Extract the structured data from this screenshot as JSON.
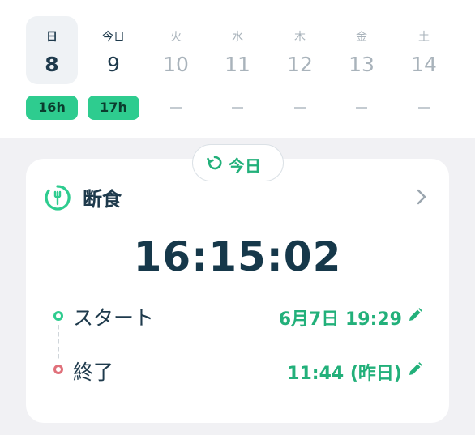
{
  "week": {
    "days": [
      {
        "dow": "日",
        "num": "8",
        "badge": "16h",
        "selected": true
      },
      {
        "dow": "今日",
        "num": "9",
        "badge": "17h"
      },
      {
        "dow": "火",
        "num": "10"
      },
      {
        "dow": "水",
        "num": "11"
      },
      {
        "dow": "木",
        "num": "12"
      },
      {
        "dow": "金",
        "num": "13"
      },
      {
        "dow": "土",
        "num": "14"
      }
    ]
  },
  "today_pill": {
    "label": "今日",
    "icon": "refresh-icon"
  },
  "card": {
    "title": "断食",
    "title_icon": "fasting-timer-icon",
    "timer": "16:15:02",
    "start": {
      "label": "スタート",
      "value": "6月7日 19:29"
    },
    "end": {
      "label": "終了",
      "value": "11:44 (昨日)"
    }
  },
  "colors": {
    "accent_green": "#2ecc8f",
    "green_text": "#22b07a",
    "end_dot": "#e0707a",
    "dark_text": "#1e3a4c",
    "muted_text": "#a9b3bb",
    "background": "#f1f1f4"
  }
}
